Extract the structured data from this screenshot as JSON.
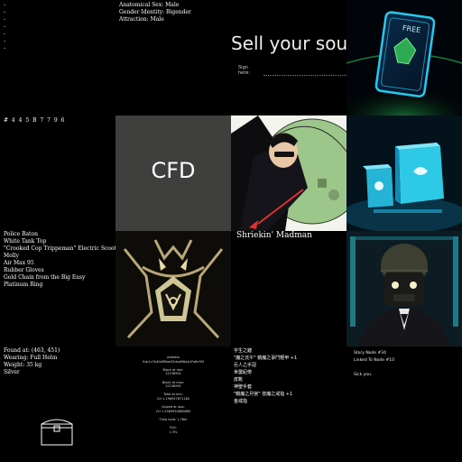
{
  "tiles": {
    "dots_tile": {
      "dots": [
        "·",
        "·",
        "·",
        "·",
        "·",
        "·",
        "·"
      ]
    },
    "identity_tile": {
      "lines": [
        "Anatomical Sex: Male",
        "Gender Identity: Bigender",
        "Attraction: Male"
      ]
    },
    "soul_tile": {
      "title": "Sell your sou",
      "sign_label": "Sign here:"
    },
    "card_tile": {
      "card_label": "FREE"
    },
    "number_tile": {
      "text": "# 4 4 5 B 7 7 9 6"
    },
    "cfd_tile": {
      "text": "CFD"
    },
    "madman_tile": {
      "title": "Shriekin' Madman"
    },
    "items_tile": {
      "lines": [
        "Police Baton",
        "White Tank Top",
        "\"Crooked Cop Trippeman\" Electric Scooter from",
        "Molly",
        "Air Max 95",
        "Rubber Gloves",
        "Gold Chain from the Big Easy",
        "Platinum Ring"
      ]
    },
    "found_tile": {
      "lines": [
        "Found at: (463, 451)",
        "Wearing: Full Helm",
        "Weight: 35 kg",
        "Silver"
      ]
    },
    "address_tile": {
      "lines": [
        "Address",
        "0xb1c7b4fa5f0be03cba8f6a4d7a6c9f4",
        "",
        "Block at min:",
        "12238901",
        "",
        "Block at max:",
        "12238991",
        "",
        "Total at min:",
        "CH 1.196957871180",
        "",
        "Solved at loss:",
        "CH 1.2589950865865",
        "",
        "Time held: 1.78m",
        "",
        "ROI:",
        "1.3%"
      ]
    },
    "chinese_tile": {
      "lines": [
        "字生之錘",
        "\"魔之氏午\" 鏡魔之爭鬥輕甲 +1",
        "巨人之手冠",
        "世襲紀帶",
        "皮靴",
        "神聖手套",
        "\"鏡魔之月宮\" 技魔之戒指 +1",
        "金戒指"
      ]
    },
    "story_tile": {
      "lines": [
        "Story Node #34",
        "Linked To Node #10",
        "",
        "Sick you."
      ]
    }
  },
  "colors": {
    "background": "#000000",
    "cfd_gray": "#3f3f3d",
    "cyan": "#2fc9e8"
  }
}
